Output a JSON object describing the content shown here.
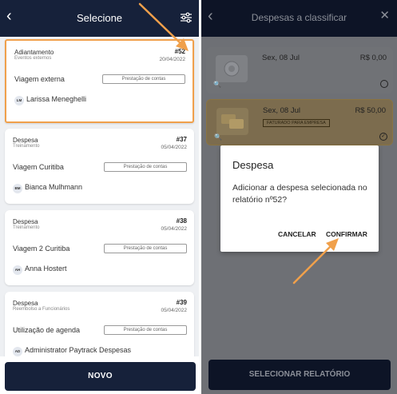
{
  "left": {
    "title": "Selecione",
    "cards": [
      {
        "type": "Adiantamento",
        "sub": "Eventos externos",
        "number": "#52",
        "date": "20/04/2022",
        "trip": "Viagem externa",
        "badge": "Prestação de contas",
        "initials": "LM",
        "person": "Larissa Meneghelli"
      },
      {
        "type": "Despesa",
        "sub": "Treinamento",
        "number": "#37",
        "date": "05/04/2022",
        "trip": "Viagem Curitiba",
        "badge": "Prestação de contas",
        "initials": "BM",
        "person": "Bianca Mulhmann"
      },
      {
        "type": "Despesa",
        "sub": "Treinamento",
        "number": "#38",
        "date": "05/04/2022",
        "trip": "Viagem 2 Curitiba",
        "badge": "Prestação de contas",
        "initials": "AH",
        "person": "Anna Hostert"
      },
      {
        "type": "Despesa",
        "sub": "Reembolso a Funcionários",
        "number": "#39",
        "date": "05/04/2022",
        "trip": "Utilização de agenda",
        "badge": "Prestação de contas",
        "initials": "AD",
        "person": "Administrator Paytrack Despesas"
      }
    ],
    "new_button": "NOVO"
  },
  "right": {
    "title": "Despesas a classificar",
    "expenses": [
      {
        "date": "Sex, 08 Jul",
        "value": "R$ 0,00"
      },
      {
        "date": "Sex, 08 Jul",
        "value": "R$ 50,00",
        "tag": "FATURADO PARA EMPRESA"
      }
    ],
    "dialog": {
      "title": "Despesa",
      "message": "Adicionar a despesa selecionada no relatório nº52?",
      "cancel": "CANCELAR",
      "confirm": "CONFIRMAR"
    },
    "select_button": "SELECIONAR RELATÓRIO"
  },
  "colors": {
    "navy": "#16213a",
    "highlight": "#f0a04b",
    "arrow": "#f0a04b"
  },
  "icons": [
    "back-arrow-icon",
    "filter-icon",
    "close-icon",
    "zoom-icon",
    "radio-icon",
    "check-icon"
  ]
}
